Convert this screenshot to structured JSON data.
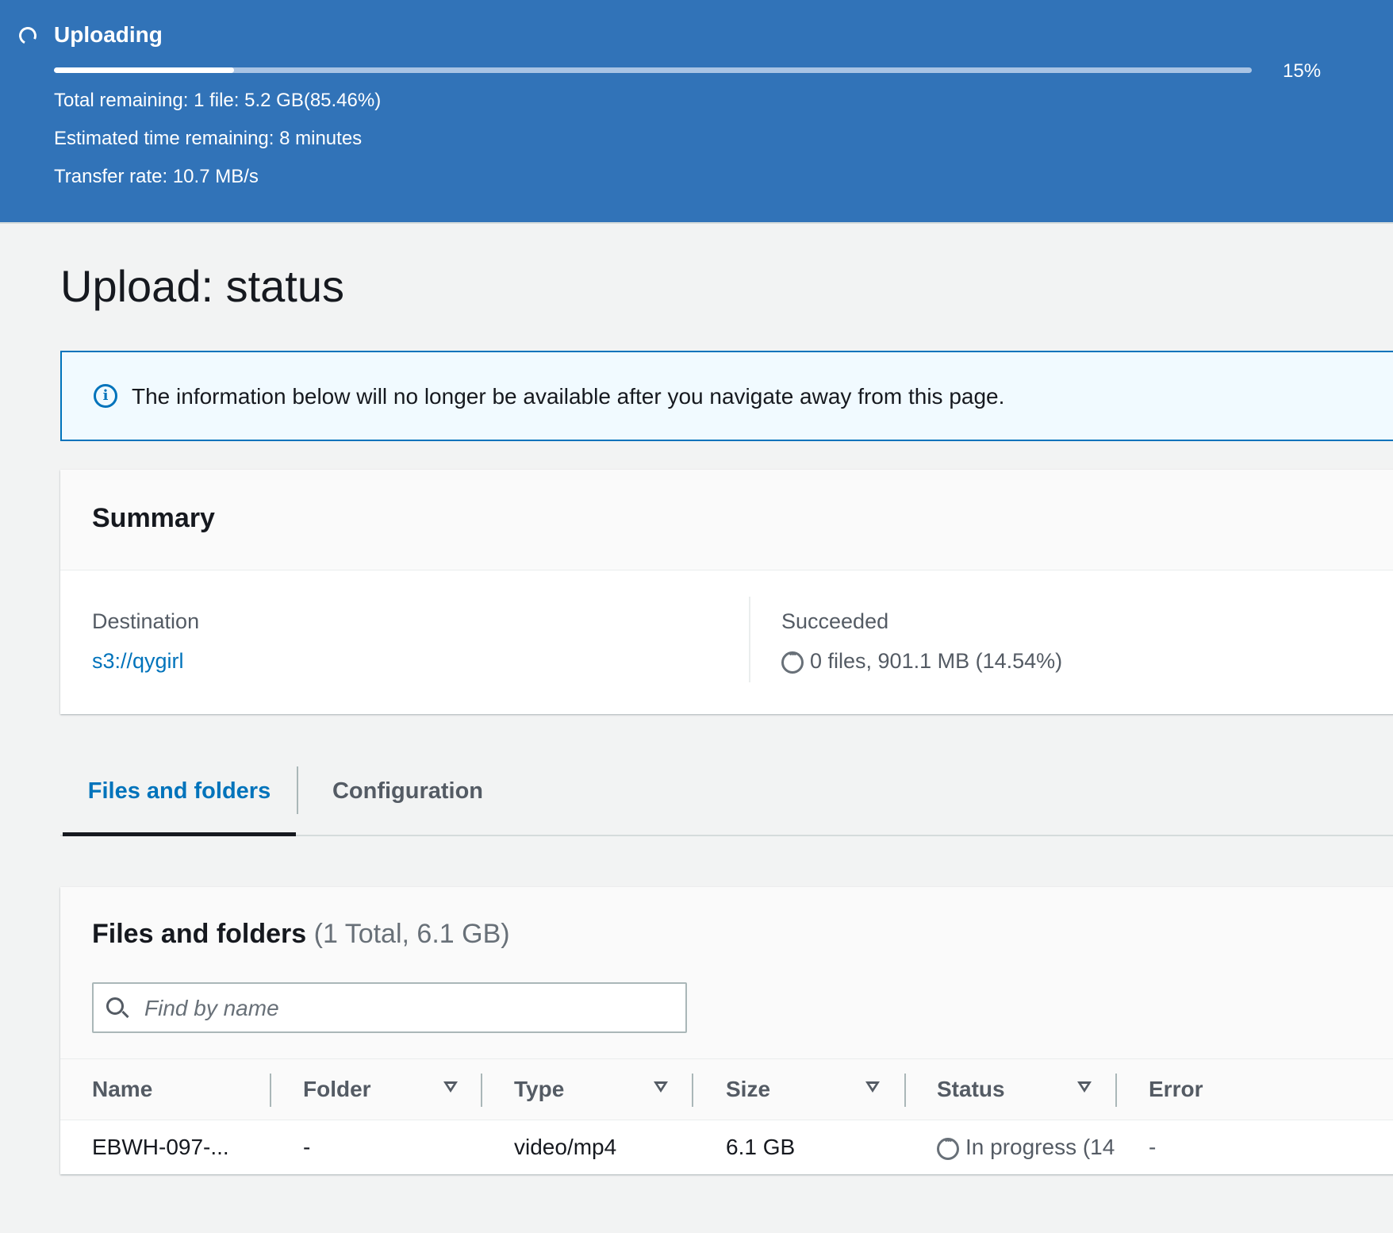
{
  "upload_banner": {
    "title": "Uploading",
    "progress_percent": 15,
    "progress_label": "15%",
    "total_remaining": "Total remaining: 1 file: 5.2 GB(85.46%)",
    "time_remaining": "Estimated time remaining: 8 minutes",
    "transfer_rate": "Transfer rate: 10.7 MB/s",
    "color": "#3173b8"
  },
  "page": {
    "title": "Upload: status"
  },
  "info_alert": {
    "text": "The information below will no longer be available after you navigate away from this page.",
    "icon": "info-icon"
  },
  "summary": {
    "title": "Summary",
    "destination_label": "Destination",
    "destination_value": "s3://qygirl",
    "succeeded_label": "Succeeded",
    "succeeded_value": "0 files, 901.1 MB (14.54%)"
  },
  "tabs": [
    {
      "label": "Files and folders",
      "active": true
    },
    {
      "label": "Configuration",
      "active": false
    }
  ],
  "files": {
    "title": "Files and folders",
    "count": "(1 Total, 6.1 GB)",
    "search_placeholder": "Find by name",
    "columns": [
      "Name",
      "Folder",
      "Type",
      "Size",
      "Status",
      "Error"
    ],
    "rows": [
      {
        "name": "EBWH-097-...",
        "folder": "-",
        "type": "video/mp4",
        "size": "6.1 GB",
        "status": "In progress (14",
        "error": "-"
      }
    ]
  },
  "colors": {
    "accent": "#0073bb",
    "active_tab_underline": "#16191f"
  }
}
